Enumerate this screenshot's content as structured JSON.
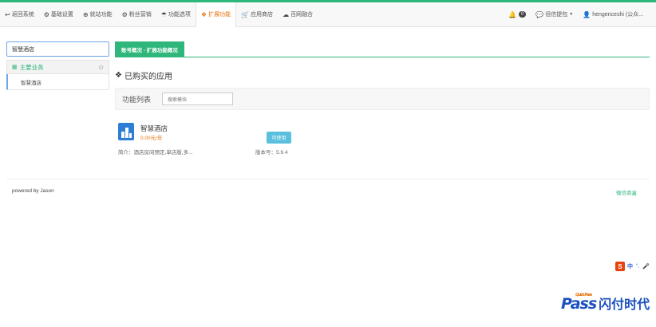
{
  "topnav": {
    "items": [
      {
        "icon": "↩",
        "label": "返回系统"
      },
      {
        "icon": "⚙",
        "label": "基础设置"
      },
      {
        "icon": "⊕",
        "label": "就站功能"
      },
      {
        "icon": "⚙",
        "label": "粉丝营销"
      },
      {
        "icon": "☂",
        "label": "功能选项"
      },
      {
        "icon": "🙾",
        "label": "扩展功能"
      },
      {
        "icon": "⛟",
        "label": "应用商店"
      },
      {
        "icon": "☁",
        "label": "百网融合"
      }
    ],
    "notification_count": "0",
    "messages_label": "徂信提包",
    "user_label": "hengenceshi (公众..."
  },
  "sidebar": {
    "search_value": "智慧酒店",
    "group_label": "主要业务",
    "items": [
      {
        "label": "智慧酒店"
      }
    ]
  },
  "main": {
    "tab_label": "账号概况 - 扩展功能概况",
    "section_title": "已购买的应用",
    "func_label": "功能列表",
    "search_placeholder": "搜索模块",
    "apps": [
      {
        "name": "智慧酒店",
        "price": "0.00元/年",
        "button": "可使用",
        "desc": "简介：酒店房间预定,单店版,多...",
        "version": "版本号：5.9.4"
      }
    ]
  },
  "footer": {
    "left": "powered by Jason",
    "right": "微信商盒"
  },
  "ime": {
    "s": "S",
    "text": "中",
    "sub": "°,"
  },
  "logo": {
    "pass": "Pass",
    "quick": "Quick Pass",
    "cn": "闪付时代"
  },
  "colors": {
    "accent": "#2fb67a",
    "active": "#e8730c",
    "button": "#5bc0de"
  }
}
